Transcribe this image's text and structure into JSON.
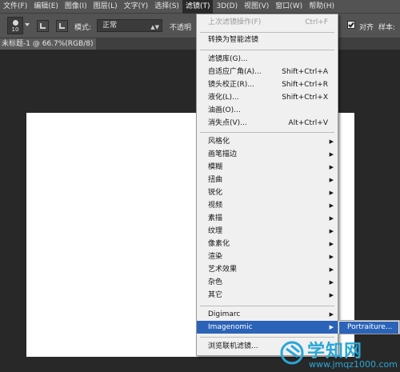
{
  "menubar": {
    "items": [
      "文件(F)",
      "编辑(E)",
      "图像(I)",
      "图层(L)",
      "文字(Y)",
      "选择(S)",
      "滤镜(T)",
      "3D(D)",
      "视图(V)",
      "窗口(W)",
      "帮助(H)"
    ],
    "active_index": 6
  },
  "options": {
    "brush_size": "10",
    "mode_label": "模式:",
    "mode_value": "正常",
    "opacity_label": "不透明",
    "align_label": "对齐",
    "sample_label": "样本:"
  },
  "document": {
    "tab_label": "未标题-1 @ 66.7%(RGB/8)",
    "canvas_color": "#ffffff"
  },
  "filter_menu": {
    "last_filter": {
      "label": "上次滤镜操作(F)",
      "shortcut": "Ctrl+F"
    },
    "smart": "转换为智能滤镜",
    "items_a": [
      {
        "label": "滤镜库(G)...",
        "shortcut": ""
      },
      {
        "label": "自适应广角(A)...",
        "shortcut": "Shift+Ctrl+A"
      },
      {
        "label": "镜头校正(R)...",
        "shortcut": "Shift+Ctrl+R"
      },
      {
        "label": "液化(L)...",
        "shortcut": "Shift+Ctrl+X"
      },
      {
        "label": "油画(O)...",
        "shortcut": ""
      },
      {
        "label": "消失点(V)...",
        "shortcut": "Alt+Ctrl+V"
      }
    ],
    "submenus": [
      "风格化",
      "画笔描边",
      "模糊",
      "扭曲",
      "锐化",
      "视频",
      "素描",
      "纹理",
      "像素化",
      "渲染",
      "艺术效果",
      "杂色",
      "其它"
    ],
    "plugins": [
      "Digimarc",
      "Imagenomic"
    ],
    "browse": "浏览联机滤镜...",
    "highlight_color": "#2b63b8"
  },
  "imagenomic_submenu": {
    "item": "Portraiture..."
  },
  "watermark": {
    "title": "学知网",
    "url": "www.jmqz1000.com",
    "color": "#2aa7d6"
  }
}
